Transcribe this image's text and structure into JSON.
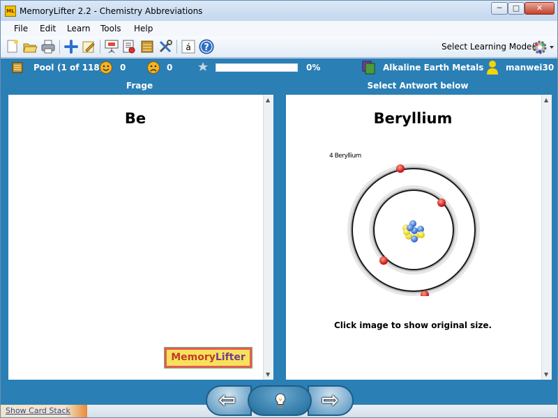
{
  "window": {
    "title": "MemoryLifter 2.2 - Chemistry Abbreviations",
    "app_icon_text": "ML",
    "controls": {
      "minimize": "─",
      "maximize": "□",
      "close": "✕"
    }
  },
  "menu": [
    "File",
    "Edit",
    "Learn",
    "Tools",
    "Help"
  ],
  "toolbar": {
    "icons": [
      "new-icon",
      "open-icon",
      "print-icon",
      "add-card-icon",
      "edit-icon",
      "presentation-icon",
      "card-list-icon",
      "stack-icon",
      "settings-tools-icon",
      "special-char-icon",
      "help-icon"
    ],
    "special_char": "á",
    "help_char": "?",
    "learning_mode_label": "Select Learning Mode(s)"
  },
  "status": {
    "pool_label": "Pool",
    "pool_count": "(1 of 118)",
    "correct_count": "0",
    "wrong_count": "0",
    "progress_percent": "0%",
    "progress_value": 0,
    "chapter": "Alkaline Earth Metals",
    "user": "manwei30"
  },
  "question": {
    "header": "Frage",
    "word": "Be"
  },
  "answer": {
    "header": "Select Antwort below",
    "word": "Beryllium",
    "image_caption": "4 Beryllium",
    "click_hint": "Click image to show original size."
  },
  "logo": {
    "part1": "Memory",
    "part2": "Lifter"
  },
  "footer": {
    "card_stack_link": "Show Card Stack"
  },
  "colors": {
    "accent": "#2a7fb5",
    "electron": "#e0201e",
    "proton": "#f2e42c",
    "neutron": "#3a7ee0"
  }
}
